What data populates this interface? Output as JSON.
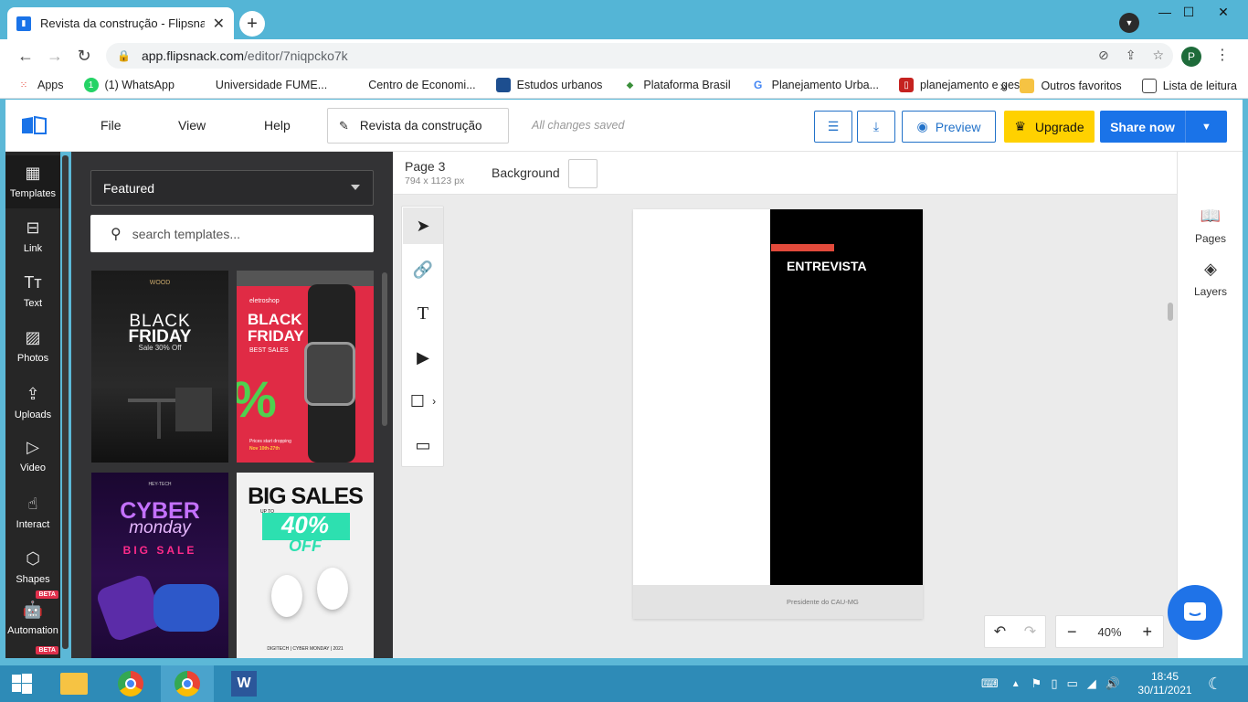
{
  "browser": {
    "tab_title": "Revista da construção - Flipsnack",
    "url_host": "app.flipsnack.com",
    "url_path": "/editor/7niqpcko7k",
    "profile_initial": "P",
    "bookmarks": [
      "Apps",
      "(1) WhatsApp",
      "Universidade FUME...",
      "Centro de Economi...",
      "Estudos urbanos",
      "Plataforma Brasil",
      "Planejamento Urba...",
      "planejamento e ges..."
    ],
    "bookmarks_right": [
      "Outros favoritos",
      "Lista de leitura"
    ]
  },
  "header": {
    "menu": [
      "File",
      "View",
      "Help"
    ],
    "doc_title": "Revista da construção",
    "save_status": "All changes saved",
    "preview_label": "Preview",
    "upgrade_label": "Upgrade",
    "share_label": "Share now"
  },
  "leftnav": {
    "items": [
      {
        "label": "Templates",
        "icon": "templates-icon"
      },
      {
        "label": "Link",
        "icon": "link-icon"
      },
      {
        "label": "Text",
        "icon": "text-icon"
      },
      {
        "label": "Photos",
        "icon": "photos-icon"
      },
      {
        "label": "Uploads",
        "icon": "uploads-icon"
      },
      {
        "label": "Video",
        "icon": "video-icon"
      },
      {
        "label": "Interact",
        "icon": "interact-icon"
      },
      {
        "label": "Shapes",
        "icon": "shapes-icon"
      },
      {
        "label": "Automation",
        "icon": "automation-icon"
      }
    ],
    "beta_label": "BETA"
  },
  "templates": {
    "category": "Featured",
    "search_placeholder": "search templates...",
    "cards": [
      {
        "brand": "WOOD",
        "line1": "BLACK",
        "line2": "FRIDAY",
        "line3": "Sale 30% Off"
      },
      {
        "brand": "eletroshop",
        "line1": "BLACK",
        "line2": "FRIDAY",
        "line3": "BEST SALES",
        "big": "%",
        "foot1": "Prices start dropping",
        "foot2": "Nov 10th-27th"
      },
      {
        "brand": "HEY-TECH",
        "line1": "CYBER",
        "line2": "monday",
        "line3": "BIG SALE"
      },
      {
        "line1": "BIG SALES",
        "line2": "40%",
        "line3": "OFF",
        "small": "UP TO",
        "foot1": "DIGITECH | CYBER MONDAY | 2021"
      }
    ]
  },
  "editor": {
    "page_label": "Page 3",
    "page_dims": "794 x 1123 px",
    "background_label": "Background",
    "page_heading": "ENTREVISTA",
    "page_caption": "Presidente do CAU-MG",
    "zoom": "40%"
  },
  "rightpanel": {
    "items": [
      {
        "label": "Pages",
        "icon": "book-icon"
      },
      {
        "label": "Layers",
        "icon": "layers-icon"
      }
    ]
  },
  "taskbar": {
    "time": "18:45",
    "date": "30/11/2021"
  },
  "colors": {
    "accent": "#1a73e8",
    "upgrade": "#ffd100",
    "nav_bg": "#262626",
    "panel_bg": "#333335",
    "titlebar": "#54b5d6"
  }
}
